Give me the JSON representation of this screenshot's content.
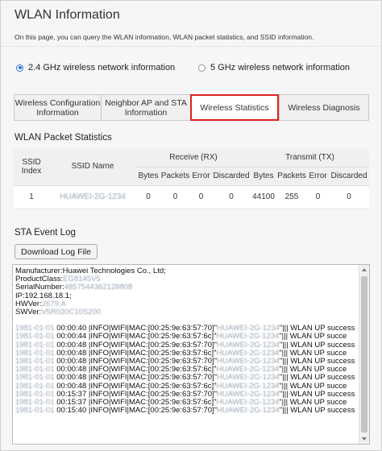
{
  "page": {
    "title": "WLAN Information",
    "description": "On this page, you can query the WLAN information, WLAN packet statistics, and SSID information."
  },
  "band_options": [
    {
      "label": "2.4 GHz wireless network information",
      "selected": true
    },
    {
      "label": "5 GHz wireless network information",
      "selected": false
    }
  ],
  "tabs": [
    {
      "label": "Wireless Configuration Information",
      "active": false
    },
    {
      "label": "Neighbor AP and STA Information",
      "active": false
    },
    {
      "label": "Wireless Statistics",
      "active": true
    },
    {
      "label": "Wireless Diagnosis",
      "active": false
    }
  ],
  "packet_stats": {
    "title": "WLAN Packet Statistics",
    "headers": {
      "ssid_index": "SSID Index",
      "ssid_name": "SSID Name",
      "receive": "Receive (RX)",
      "transmit": "Transmit (TX)",
      "bytes": "Bytes",
      "packets": "Packets",
      "error": "Error",
      "discarded": "Discarded"
    },
    "rows": [
      {
        "index": "1",
        "name": "HUAWEI-2G-1234",
        "rx_bytes": "0",
        "rx_packets": "0",
        "rx_error": "0",
        "rx_discarded": "0",
        "tx_bytes": "44100",
        "tx_packets": "255",
        "tx_error": "0",
        "tx_discarded": "0"
      }
    ]
  },
  "event_log": {
    "title": "STA Event Log",
    "download_label": "Download Log File",
    "header_lines": [
      "Manufacturer:Huawei Technologies Co., Ltd;",
      "ProductClass:",
      "SerialNumber:",
      "IP:192.168.18.1;",
      "HWVer:",
      "SWVer:"
    ],
    "header_masked": [
      "",
      "EG8145V5",
      "4857544362128808",
      "",
      "2679.A",
      "V5R020C10S200"
    ],
    "entries": [
      {
        "date": "1981-01-01",
        "time": "00:00:40",
        "mac": "00:25:9e:63:57:70",
        "ssid": "HUAWEI-2G-1234",
        "msg": "WLAN UP success"
      },
      {
        "date": "1981-01-01",
        "time": "00:00:44",
        "mac": "00:25:9e:63:57:6c",
        "ssid": "HUAWEI-2G-1234",
        "msg": "WLAN UP succe"
      },
      {
        "date": "1981-01-01",
        "time": "00:00:48",
        "mac": "00:25:9e:63:57:70",
        "ssid": "HUAWEI-2G-1234",
        "msg": "WLAN UP success"
      },
      {
        "date": "1981-01-01",
        "time": "00:00:48",
        "mac": "00:25:9e:63:57:6c",
        "ssid": "HUAWEI-2G-1234",
        "msg": "WLAN UP succe"
      },
      {
        "date": "1981-01-01",
        "time": "00:00:48",
        "mac": "00:25:9e:63:57:70",
        "ssid": "HUAWEI-2G-1234",
        "msg": "WLAN UP success"
      },
      {
        "date": "1981-01-01",
        "time": "00:00:48",
        "mac": "00:25:9e:63:57:6c",
        "ssid": "HUAWEI-2G-1234",
        "msg": "WLAN UP succe"
      },
      {
        "date": "1981-01-01",
        "time": "00:00:48",
        "mac": "00:25:9e:63:57:70",
        "ssid": "HUAWEI-2G-1234",
        "msg": "WLAN UP success"
      },
      {
        "date": "1981-01-01",
        "time": "00:00:48",
        "mac": "00:25:9e:63:57:6c",
        "ssid": "HUAWEI-2G-1234",
        "msg": "WLAN UP succe"
      },
      {
        "date": "1981-01-01",
        "time": "00:15:37",
        "mac": "00:25:9e:63:57:70",
        "ssid": "HUAWEI-2G-1234",
        "msg": "WLAN UP success"
      },
      {
        "date": "1981-01-01",
        "time": "00:15:37",
        "mac": "00:25:9e:63:57:6c",
        "ssid": "HUAWEI-2G-1234",
        "msg": "WLAN UP succe"
      },
      {
        "date": "1981-01-01",
        "time": "00:15:40",
        "mac": "00:25:9e:63:57:70",
        "ssid": "HUAWEI-2G-1234",
        "msg": "WLAN UP success"
      }
    ],
    "entry_info": "|INFO|WIFI|MAC:["
  },
  "colors": {
    "accent_radio": "#2e6fd6",
    "active_tab_border": "#e02020",
    "masked_text": "#9aa6b4"
  },
  "icons": {
    "scroll_up": "arrow-up-icon",
    "scroll_down": "arrow-down-icon"
  }
}
